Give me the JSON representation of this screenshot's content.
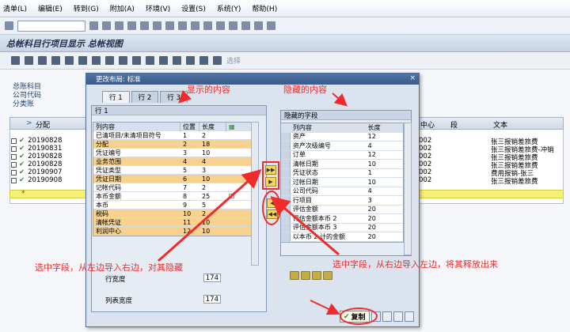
{
  "menu": [
    "清单(L)",
    "编辑(E)",
    "转到(G)",
    "附加(A)",
    "环境(V)",
    "设置(S)",
    "系统(Y)",
    "帮助(H)"
  ],
  "window_title": "总帐科目行项目显示 总帐视图",
  "app_toolbar_select": "选择",
  "header_labels": [
    "总账科目",
    "公司代码",
    "分类账"
  ],
  "table": {
    "columns": [
      "分配",
      "中心",
      "段",
      "文本"
    ],
    "rows": [
      {
        "date": "20190828",
        "code": "002",
        "text": "张三报销差旅费"
      },
      {
        "date": "20190831",
        "code": "002",
        "text": "张三报销差旅费-冲销"
      },
      {
        "date": "20190828",
        "code": "002",
        "text": "张三报销差旅费"
      },
      {
        "date": "20190828",
        "code": "002",
        "text": "张三报销差旅费"
      },
      {
        "date": "20190907",
        "code": "002",
        "text": "费用报销-张三"
      },
      {
        "date": "20190908",
        "code": "002",
        "text": "张三报销差旅费"
      }
    ]
  },
  "dialog": {
    "title": "更改布局: 标准",
    "tabs": [
      "行 1",
      "行 2",
      "行 3"
    ],
    "left_panel_title": "行 1",
    "left_columns": [
      "列内容",
      "位置",
      "长度"
    ],
    "left_rows": [
      {
        "name": "已清项目/未清项目符号",
        "pos": "1",
        "len": "2",
        "highlight": false
      },
      {
        "name": "分配",
        "pos": "2",
        "len": "18",
        "highlight": true
      },
      {
        "name": "凭证编号",
        "pos": "3",
        "len": "10",
        "highlight": false
      },
      {
        "name": "业务范围",
        "pos": "4",
        "len": "4",
        "highlight": true
      },
      {
        "name": "凭证类型",
        "pos": "5",
        "len": "3",
        "highlight": false
      },
      {
        "name": "凭证日期",
        "pos": "6",
        "len": "10",
        "highlight": true
      },
      {
        "name": "记帐代码",
        "pos": "7",
        "len": "2",
        "highlight": false
      },
      {
        "name": "本币金额",
        "pos": "8",
        "len": "25",
        "highlight": false,
        "checked": true
      },
      {
        "name": "本币",
        "pos": "9",
        "len": "5",
        "highlight": false
      },
      {
        "name": "税码",
        "pos": "10",
        "len": "2",
        "highlight": true
      },
      {
        "name": "清帐凭证",
        "pos": "11",
        "len": "10",
        "highlight": true
      },
      {
        "name": "利润中心",
        "pos": "12",
        "len": "10",
        "highlight": true
      }
    ],
    "row_width_label": "行宽度",
    "row_width_value": "174",
    "list_width_label": "列表宽度",
    "list_width_value": "174",
    "right_panel_title": "隐藏的字段",
    "right_columns": [
      "列内容",
      "长度"
    ],
    "right_rows": [
      {
        "name": "资产",
        "len": "12"
      },
      {
        "name": "资产次级编号",
        "len": "4"
      },
      {
        "name": "订单",
        "len": "12"
      },
      {
        "name": "清帐日期",
        "len": "10"
      },
      {
        "name": "凭证状态",
        "len": "1"
      },
      {
        "name": "过帐日期",
        "len": "10"
      },
      {
        "name": "公司代码",
        "len": "4"
      },
      {
        "name": "行项目",
        "len": "3"
      },
      {
        "name": "评估金额",
        "len": "20"
      },
      {
        "name": "评估金额本币 2",
        "len": "20"
      },
      {
        "name": "评估金额本币 3",
        "len": "20"
      },
      {
        "name": "以本币 2 计的金额",
        "len": "20"
      }
    ],
    "copy_button": "复制"
  },
  "annotations": {
    "shown": "显示的内容",
    "hidden": "隐藏的内容",
    "left_to_right": "选中字段，从左边导入右边，对其隐藏",
    "right_to_left": "选中字段，从右边导入左边，将其释放出来"
  },
  "colors": {
    "accent_red": "#ef2b2b",
    "highlight_row": "#f6d28e",
    "yellow_row": "#f4f177"
  }
}
